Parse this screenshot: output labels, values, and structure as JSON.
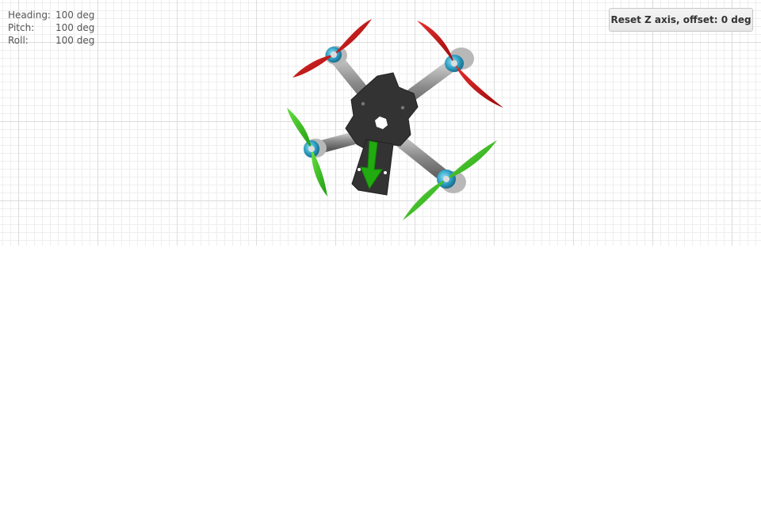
{
  "readout": {
    "heading_label": "Heading:",
    "heading_value": "100 deg",
    "pitch_label": "Pitch:",
    "pitch_value": "100 deg",
    "roll_label": "Roll:",
    "roll_value": "100 deg"
  },
  "toolbar": {
    "reset_label": "Reset Z axis, offset: 0 deg"
  },
  "colors": {
    "front_props": "#cc1111",
    "rear_props": "#33bb22",
    "frame": "#333333",
    "arms": "#888888",
    "motors": "#33a8cc",
    "direction_arrow": "#22aa11"
  },
  "icons": {
    "model": "quadcopter-model",
    "arrow": "direction-arrow-icon"
  }
}
